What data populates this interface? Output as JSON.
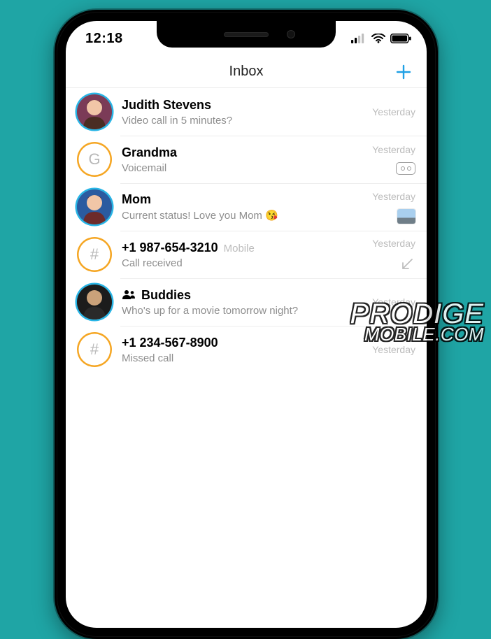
{
  "status": {
    "time": "12:18"
  },
  "nav": {
    "title": "Inbox",
    "add_label": "Add"
  },
  "rows": [
    {
      "name": "Judith Stevens",
      "sublabel": "",
      "preview": "Video call in 5 minutes?",
      "date": "Yesterday",
      "avatar": {
        "kind": "photo",
        "letter": "",
        "ring": "blue"
      },
      "access": "none",
      "group": false
    },
    {
      "name": "Grandma",
      "sublabel": "",
      "preview": "Voicemail",
      "date": "Yesterday",
      "avatar": {
        "kind": "letter",
        "letter": "G",
        "ring": "orange"
      },
      "access": "voicemail",
      "group": false
    },
    {
      "name": "Mom",
      "sublabel": "",
      "preview": "Current status! Love you Mom 😘",
      "date": "Yesterday",
      "avatar": {
        "kind": "photo",
        "letter": "",
        "ring": "blue"
      },
      "access": "thumb",
      "group": false
    },
    {
      "name": "+1 987-654-3210",
      "sublabel": "Mobile",
      "preview": "Call received",
      "date": "Yesterday",
      "avatar": {
        "kind": "hash",
        "letter": "#",
        "ring": "orange"
      },
      "access": "incoming",
      "group": false
    },
    {
      "name": "Buddies",
      "sublabel": "",
      "preview": "Who's up for a movie tomorrow night?",
      "date": "Yesterday",
      "avatar": {
        "kind": "photo",
        "letter": "",
        "ring": "blue"
      },
      "access": "none",
      "group": true
    },
    {
      "name": "+1 234-567-8900",
      "sublabel": "",
      "preview": "Missed call",
      "date": "Yesterday",
      "avatar": {
        "kind": "hash",
        "letter": "#",
        "ring": "orange"
      },
      "access": "none",
      "group": false
    }
  ],
  "watermark": {
    "line1": "PRODIGE",
    "line2": "MOBILE.COM"
  }
}
